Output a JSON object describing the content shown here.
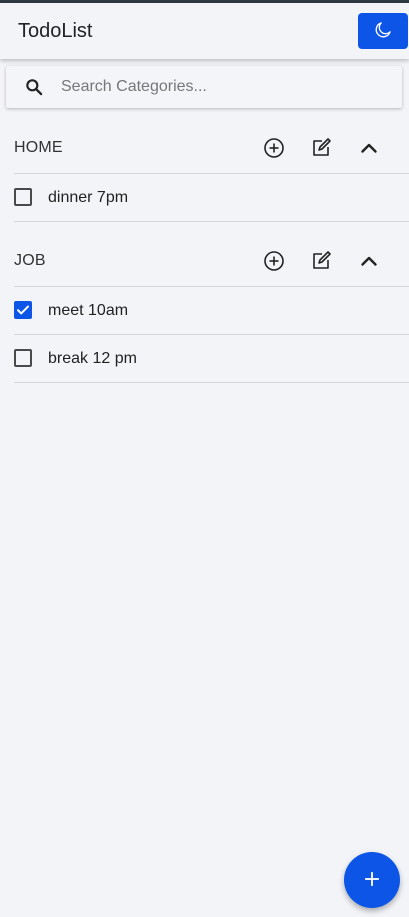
{
  "app": {
    "title": "TodoList"
  },
  "colors": {
    "accent": "#0d55e7",
    "background": "#f3f4f8",
    "divider": "#d6d7dc"
  },
  "header": {
    "theme_toggle_icon": "moon-icon"
  },
  "search": {
    "placeholder": "Search Categories...",
    "value": "",
    "icon": "search-icon"
  },
  "categories": [
    {
      "name": "HOME",
      "actions": [
        "add-circle-icon",
        "edit-icon",
        "chevron-up-icon"
      ],
      "expanded": true,
      "tasks": [
        {
          "label": "dinner 7pm",
          "done": false
        }
      ]
    },
    {
      "name": "JOB",
      "actions": [
        "add-circle-icon",
        "edit-icon",
        "chevron-up-icon"
      ],
      "expanded": true,
      "tasks": [
        {
          "label": "meet 10am",
          "done": true
        },
        {
          "label": "break 12 pm",
          "done": false
        }
      ]
    }
  ],
  "fab": {
    "icon": "plus-icon"
  }
}
